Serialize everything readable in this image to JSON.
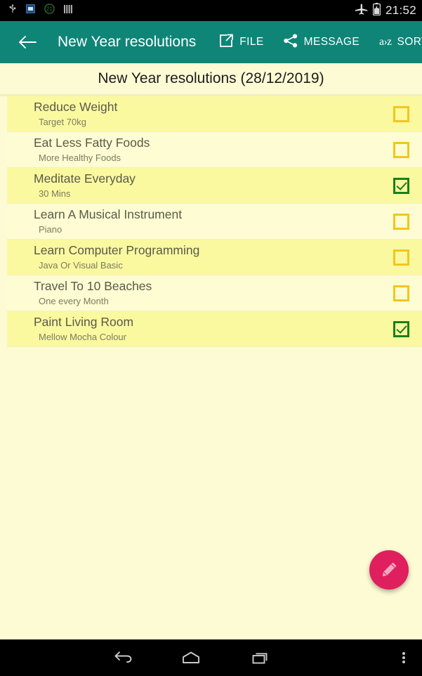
{
  "status_bar": {
    "icons": [
      "usb-icon",
      "sd-card-icon",
      "alarm-badge-icon",
      "signal-bars-icon"
    ],
    "alarm_badge_text": "21",
    "right_icons": [
      "airplane-mode-icon",
      "battery-charging-icon"
    ],
    "clock": "21:52"
  },
  "app_bar": {
    "back_label": "Back",
    "title": "New Year resolutions",
    "actions": [
      {
        "id": "file",
        "label": "FILE",
        "icon": "share-export-icon"
      },
      {
        "id": "message",
        "label": "MESSAGE",
        "icon": "share-nodes-icon"
      },
      {
        "id": "sort",
        "label": "SORT",
        "icon": "a-to-z-sort-icon",
        "glyph": "a›z"
      }
    ]
  },
  "list_header": {
    "text": "New Year resolutions (28/12/2019)"
  },
  "list": {
    "items": [
      {
        "title": "Reduce Weight",
        "subtitle": "Target 70kg",
        "checked": false
      },
      {
        "title": "Eat Less Fatty Foods",
        "subtitle": "More Healthy Foods",
        "checked": false
      },
      {
        "title": "Meditate Everyday",
        "subtitle": "30 Mins",
        "checked": true
      },
      {
        "title": "Learn A Musical Instrument",
        "subtitle": "Piano",
        "checked": false
      },
      {
        "title": "Learn Computer Programming",
        "subtitle": "Java Or Visual Basic",
        "checked": false
      },
      {
        "title": "Travel To 10 Beaches",
        "subtitle": "One every Month",
        "checked": false
      },
      {
        "title": "Paint Living Room",
        "subtitle": "Mellow Mocha Colour",
        "checked": true
      }
    ]
  },
  "fab": {
    "icon": "pencil-icon",
    "label": "Add resolution"
  },
  "nav_bar": {
    "buttons": [
      {
        "id": "back",
        "icon": "nav-back-icon"
      },
      {
        "id": "home",
        "icon": "nav-home-icon"
      },
      {
        "id": "recents",
        "icon": "nav-recents-icon"
      },
      {
        "id": "overflow",
        "icon": "nav-overflow-icon"
      }
    ]
  },
  "colors": {
    "app_bar": "#0e8577",
    "page_background": "#fdfbd4",
    "row_odd": "#fbf99f",
    "row_even": "#fdfcd2",
    "checkbox_unchecked": "#f3c51d",
    "checkbox_checked": "#1a8018",
    "fab": "#e01f5e",
    "nav_bar": "#000000"
  }
}
